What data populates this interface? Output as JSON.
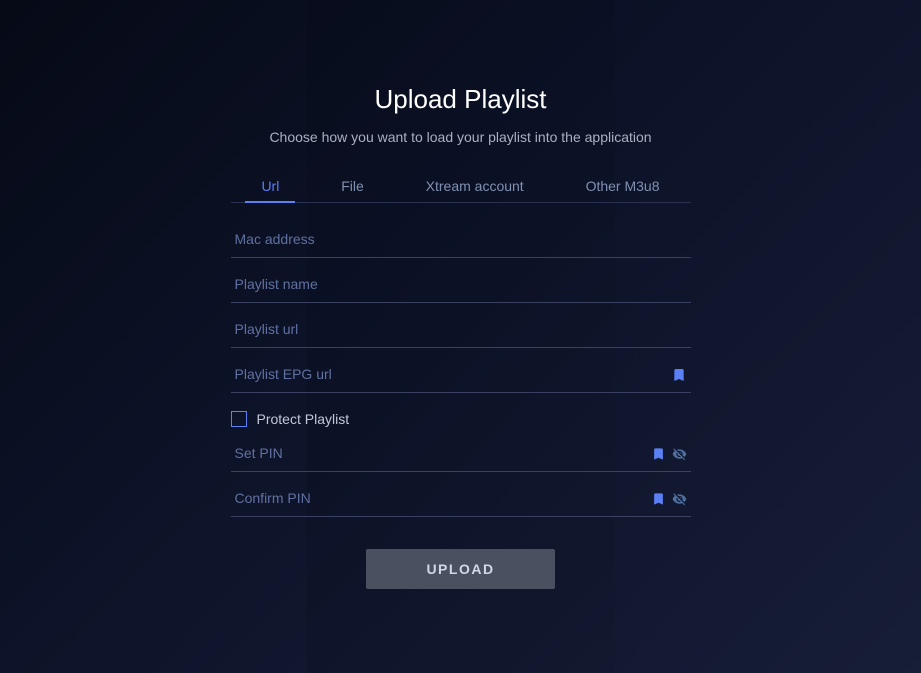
{
  "background": {
    "alt": "TV show thumbnails background"
  },
  "dialog": {
    "title": "Upload Playlist",
    "subtitle": "Choose how you want to load your playlist into the application"
  },
  "tabs": [
    {
      "id": "url",
      "label": "Url",
      "active": true
    },
    {
      "id": "file",
      "label": "File",
      "active": false
    },
    {
      "id": "xtream",
      "label": "Xtream account",
      "active": false
    },
    {
      "id": "m3u8",
      "label": "Other M3u8",
      "active": false
    }
  ],
  "fields": {
    "mac_address": {
      "placeholder": "Mac address"
    },
    "playlist_name": {
      "placeholder": "Playlist name"
    },
    "playlist_url": {
      "placeholder": "Playlist url"
    },
    "playlist_epg_url": {
      "placeholder": "Playlist EPG url"
    },
    "set_pin": {
      "placeholder": "Set PIN"
    },
    "confirm_pin": {
      "placeholder": "Confirm PIN"
    }
  },
  "protect": {
    "label": "Protect Playlist"
  },
  "upload_button": {
    "label": "UPLOAD"
  },
  "icons": {
    "bookmark": "🔖",
    "eye_off": "⊘",
    "eye_off2": "⊘"
  }
}
